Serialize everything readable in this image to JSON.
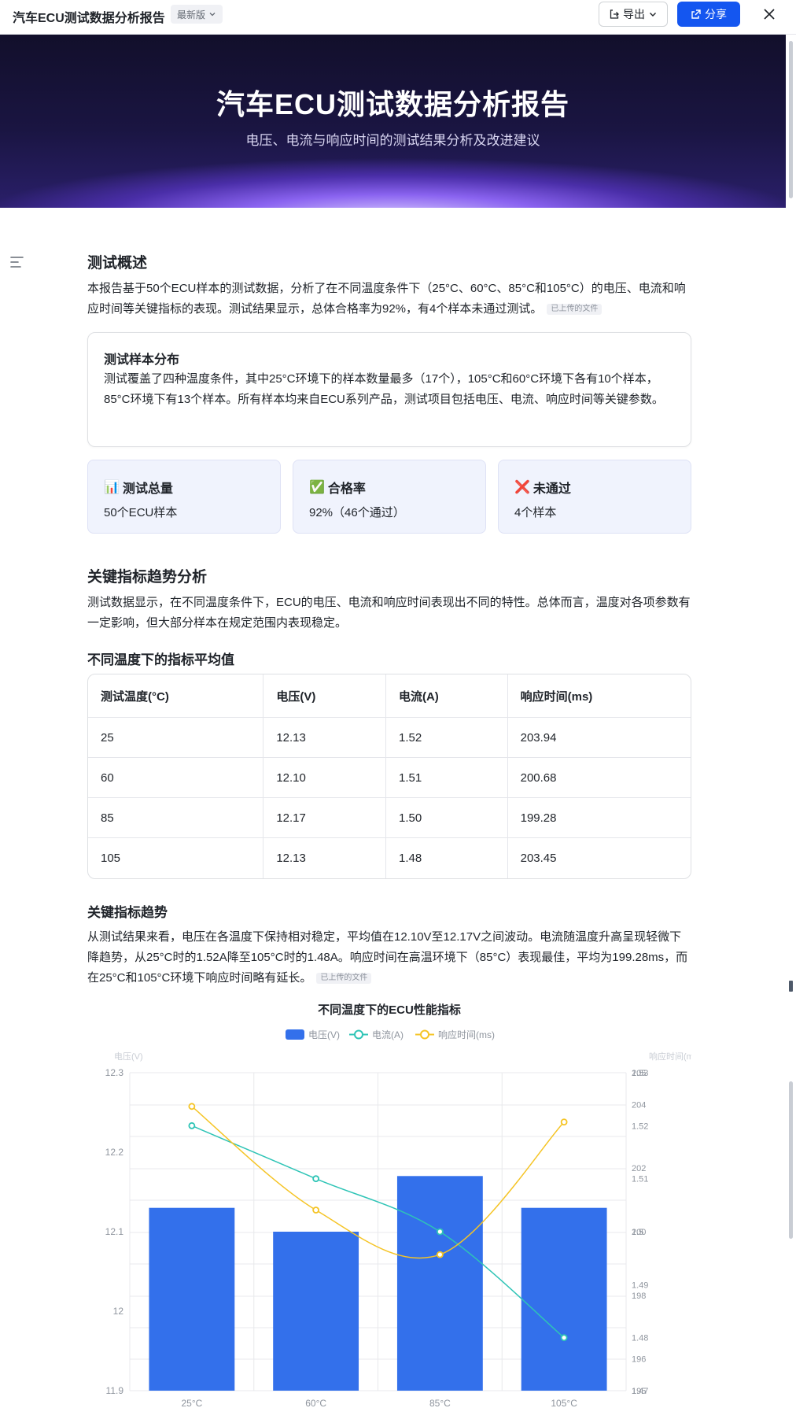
{
  "topbar": {
    "title": "汽车ECU测试数据分析报告",
    "version": "最新版",
    "export_label": "导出",
    "share_label": "分享"
  },
  "hero": {
    "title": "汽车ECU测试数据分析报告",
    "subtitle": "电压、电流与响应时间的测试结果分析及改进建议"
  },
  "overview": {
    "heading": "测试概述",
    "para": "本报告基于50个ECU样本的测试数据，分析了在不同温度条件下（25°C、60°C、85°C和105°C）的电压、电流和响应时间等关键指标的表现。测试结果显示，总体合格率为92%，有4个样本未通过测试。",
    "file_tag": "已上传的文件"
  },
  "distribution": {
    "title": "测试样本分布",
    "para": "测试覆盖了四种温度条件，其中25°C环境下的样本数量最多（17个），105°C和60°C环境下各有10个样本，85°C环境下有13个样本。所有样本均来自ECU系列产品，测试项目包括电压、电流、响应时间等关键参数。"
  },
  "stats": [
    {
      "icon": "📊",
      "icon_name": "bar-chart-icon",
      "title": "测试总量",
      "value": "50个ECU样本"
    },
    {
      "icon": "✅",
      "icon_name": "check-mark-icon",
      "title": "合格率",
      "value": "92%（46个通过）"
    },
    {
      "icon": "❌",
      "icon_name": "cross-mark-icon",
      "title": "未通过",
      "value": "4个样本"
    }
  ],
  "trend": {
    "heading": "关键指标趋势分析",
    "para": "测试数据显示，在不同温度条件下，ECU的电压、电流和响应时间表现出不同的特性。总体而言，温度对各项参数有一定影响，但大部分样本在规定范围内表现稳定。",
    "table_heading": "不同温度下的指标平均值",
    "table": {
      "headers": [
        "测试温度(°C)",
        "电压(V)",
        "电流(A)",
        "响应时间(ms)"
      ],
      "rows": [
        [
          "25",
          "12.13",
          "1.52",
          "203.94"
        ],
        [
          "60",
          "12.10",
          "1.51",
          "200.68"
        ],
        [
          "85",
          "12.17",
          "1.50",
          "199.28"
        ],
        [
          "105",
          "12.13",
          "1.48",
          "203.45"
        ]
      ]
    }
  },
  "key_trend": {
    "heading": "关键指标趋势",
    "para": "从测试结果来看，电压在各温度下保持相对稳定，平均值在12.10V至12.17V之间波动。电流随温度升高呈现轻微下降趋势，从25°C时的1.52A降至105°C时的1.48A。响应时间在高温环境下（85°C）表现最佳，平均为199.28ms，而在25°C和105°C环境下响应时间略有延长。",
    "file_tag": "已上传的文件"
  },
  "chart_data": {
    "type": "bar",
    "title": "不同温度下的ECU性能指标",
    "categories": [
      "25°C",
      "60°C",
      "85°C",
      "105°C"
    ],
    "ylabel": "电压(V)",
    "ylabel_right": "响应时间(ms)",
    "ylim": [
      11.9,
      12.3
    ],
    "y_ticks": [
      "12.3",
      "12.2",
      "12.1",
      "12",
      "11.9"
    ],
    "y2_ticks_current": [
      "1.53",
      "1.52",
      "1.51",
      "1.5",
      "1.49",
      "1.48",
      "1.47"
    ],
    "y2_ticks_response": [
      "205",
      "204",
      "202",
      "200",
      "198",
      "196",
      "195"
    ],
    "series": [
      {
        "name": "电压(V)",
        "type": "bar",
        "values": [
          12.13,
          12.1,
          12.17,
          12.13
        ],
        "color": "#3370eb"
      },
      {
        "name": "电流(A)",
        "type": "line",
        "values": [
          1.52,
          1.51,
          1.5,
          1.48
        ],
        "color": "#2ec4b6",
        "ylim": [
          1.47,
          1.53
        ]
      },
      {
        "name": "响应时间(ms)",
        "type": "line",
        "values": [
          203.94,
          200.68,
          199.28,
          203.45
        ],
        "color": "#f5c425",
        "ylim": [
          195,
          205
        ]
      }
    ],
    "grid": true,
    "legend": "top-center"
  }
}
